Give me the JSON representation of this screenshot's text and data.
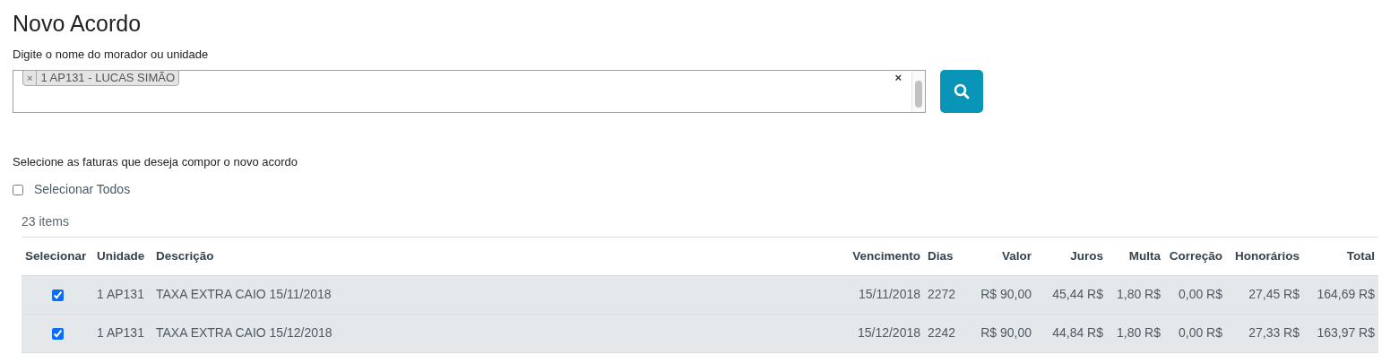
{
  "title": "Novo Acordo",
  "search": {
    "label": "Digite o nome do morador ou unidade",
    "tags": [
      {
        "remove": "×",
        "text": "1 AP131 - LUCAS SIMÃO"
      }
    ],
    "clear": "×"
  },
  "instructions": "Selecione as faturas que deseja compor o novo acordo",
  "select_all": {
    "label": "Selecionar Todos",
    "checked": false
  },
  "count": "23 items",
  "table": {
    "columns": [
      "Selecionar",
      "Unidade",
      "Descrição",
      "Vencimento",
      "Dias",
      "Valor",
      "Juros",
      "Multa",
      "Correção",
      "Honorários",
      "Total"
    ],
    "rows": [
      {
        "selected": true,
        "cells": [
          "",
          "1 AP131",
          "TAXA EXTRA CAIO 15/11/2018",
          "15/11/2018",
          "2272",
          "R$ 90,00",
          "45,44 R$",
          "1,80 R$",
          "0,00 R$",
          "27,45 R$",
          "164,69 R$"
        ]
      },
      {
        "selected": true,
        "cells": [
          "",
          "1 AP131",
          "TAXA EXTRA CAIO 15/12/2018",
          "15/12/2018",
          "2242",
          "R$ 90,00",
          "44,84 R$",
          "1,80 R$",
          "0,00 R$",
          "27,33 R$",
          "163,97 R$"
        ]
      }
    ]
  }
}
